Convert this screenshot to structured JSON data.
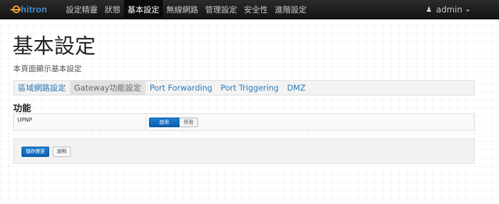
{
  "app": {
    "brand": "hitron",
    "brand_color": "#3f8fd2",
    "brand_accent": "#f0a42c"
  },
  "nav": {
    "items": [
      {
        "label": "設定精靈",
        "active": false
      },
      {
        "label": "狀態",
        "active": false
      },
      {
        "label": "基本設定",
        "active": true
      },
      {
        "label": "無線網路",
        "active": false
      },
      {
        "label": "管理設定",
        "active": false
      },
      {
        "label": "安全性",
        "active": false
      },
      {
        "label": "進階設定",
        "active": false
      }
    ],
    "user": {
      "name": "admin",
      "icon": "user-icon"
    }
  },
  "page": {
    "title": "基本設定",
    "subtitle": "本頁面顯示基本設定"
  },
  "tabs": [
    {
      "label": "區域網路設定",
      "active": false
    },
    {
      "label": "Gateway功能設定",
      "active": true
    },
    {
      "label": "Port Forwarding",
      "active": false
    },
    {
      "label": "Port Triggering",
      "active": false
    },
    {
      "label": "DMZ",
      "active": false
    }
  ],
  "section": {
    "title": "功能",
    "settings": [
      {
        "label": "UPNP",
        "options": [
          "啟用",
          "停用"
        ],
        "selected": "啟用"
      }
    ]
  },
  "actions": {
    "save_label": "儲存變更",
    "help_label": "說明"
  },
  "colors": {
    "primary": "#0d6cc2",
    "link": "#2a7ab8",
    "navbar": "#1e1e1e"
  }
}
